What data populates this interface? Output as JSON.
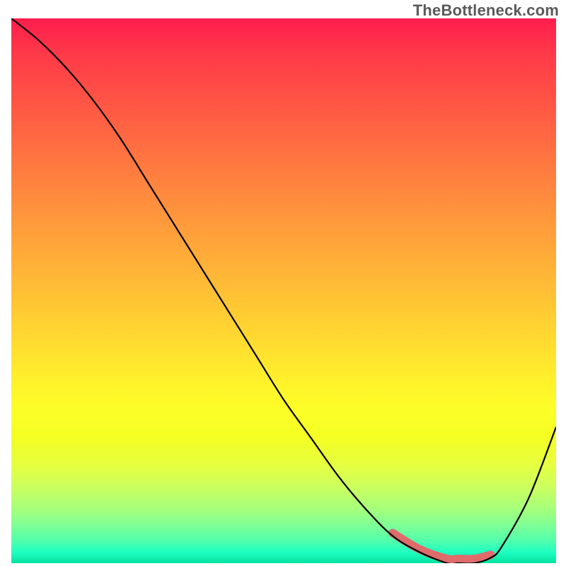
{
  "attribution": "TheBottleneck.com",
  "colors": {
    "curve": "#000000",
    "trough_highlight": "#df6b6b",
    "gradient_top": "#ff1d4d",
    "gradient_bottom": "#05E2A0"
  },
  "chart_data": {
    "type": "line",
    "title": "",
    "xlabel": "",
    "ylabel": "",
    "xlim": [
      0,
      100
    ],
    "ylim": [
      0,
      100
    ],
    "x": [
      0,
      5,
      10,
      15,
      20,
      25,
      30,
      35,
      40,
      45,
      50,
      55,
      60,
      65,
      70,
      75,
      80,
      82,
      85,
      88,
      90,
      95,
      100
    ],
    "series": [
      {
        "name": "curve",
        "values": [
          100,
          96,
          91,
          85,
          78,
          70,
          62,
          54,
          46,
          38,
          30,
          23,
          16,
          10,
          5,
          2,
          0,
          0,
          0,
          1,
          3,
          12,
          25
        ]
      }
    ],
    "trough_range_x": [
      70,
      88
    ],
    "legend": false,
    "grid": false
  }
}
